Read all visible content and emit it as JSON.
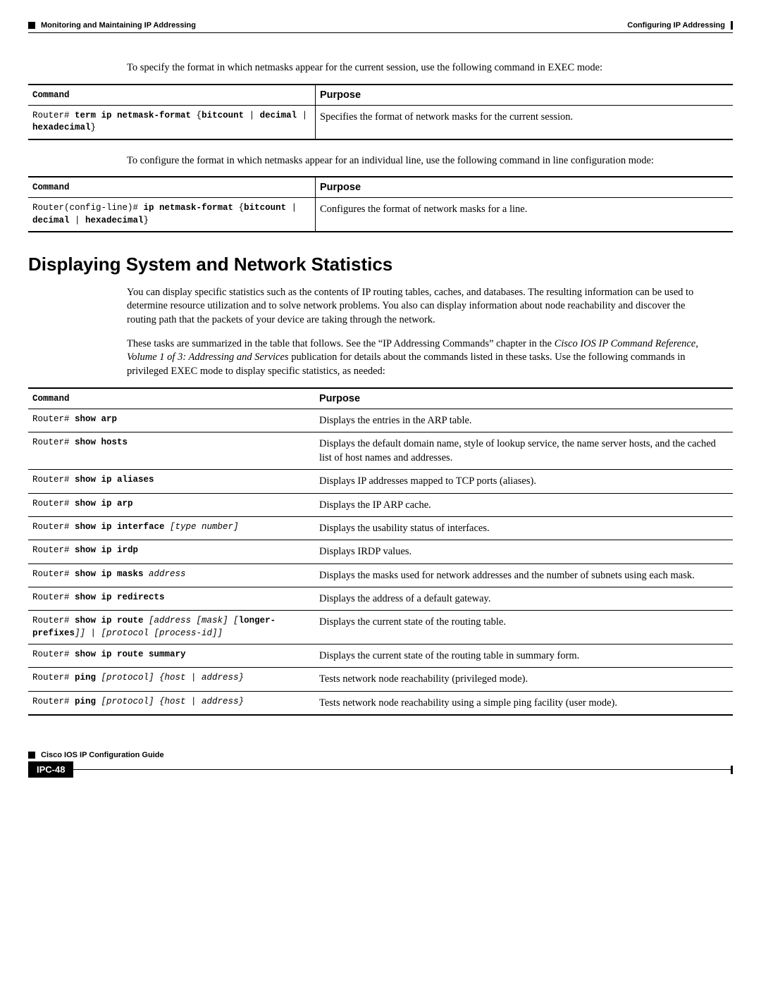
{
  "header": {
    "chapter": "Configuring IP Addressing",
    "section": "Monitoring and Maintaining IP Addressing"
  },
  "intro1": "To specify the format in which netmasks appear for the current session, use the following command in EXEC mode:",
  "table1": {
    "hdr_cmd": "Command",
    "hdr_purpose": "Purpose",
    "rows": [
      {
        "prompt": "Router# ",
        "kw1": "term ip netmask-format",
        "opts": " {",
        "opt1": "bitcount",
        "sep1": " | ",
        "opt2": "decimal",
        "sep2": " | ",
        "opt3": "hexadecimal",
        "close": "}",
        "purpose": "Specifies the format of network masks for the current session."
      }
    ]
  },
  "intro2": "To configure the format in which netmasks appear for an individual line, use the following command in line configuration mode:",
  "table2": {
    "hdr_cmd": "Command",
    "hdr_purpose": "Purpose",
    "rows": [
      {
        "prompt": "Router(config-line)# ",
        "kw1": "ip netmask-format",
        "opts": " {",
        "opt1": "bitcount",
        "sep1": " | ",
        "opt2": "decimal",
        "sep2": " | ",
        "opt3": "hexadecimal",
        "close": "}",
        "purpose": "Configures the format of network masks for a line."
      }
    ]
  },
  "heading2": "Displaying System and Network Statistics",
  "para2a": "You can display specific statistics such as the contents of IP routing tables, caches, and databases. The resulting information can be used to determine resource utilization and to solve network problems. You also can display information about node reachability and discover the routing path that the packets of your device are taking through the network.",
  "para2b_pre": "These tasks are summarized in the table that follows. See the “IP Addressing Commands” chapter in the ",
  "para2b_italic": "Cisco IOS IP Command Reference, Volume 1 of 3: Addressing and Services",
  "para2b_post": " publication for details about the commands listed in these tasks. Use the following commands in privileged EXEC mode to display specific statistics, as needed:",
  "table3": {
    "hdr_cmd": "Command",
    "hdr_purpose": "Purpose",
    "rows": [
      {
        "prompt": "Router# ",
        "kw": "show arp",
        "args": "",
        "purpose": "Displays the entries in the ARP table."
      },
      {
        "prompt": "Router# ",
        "kw": "show hosts",
        "args": "",
        "purpose": "Displays the default domain name, style of lookup service, the name server hosts, and the cached list of host names and addresses."
      },
      {
        "prompt": "Router# ",
        "kw": "show ip aliases",
        "args": "",
        "purpose": "Displays IP addresses mapped to TCP ports (aliases)."
      },
      {
        "prompt": "Router# ",
        "kw": "show ip arp",
        "args": "",
        "purpose": "Displays the IP ARP cache."
      },
      {
        "prompt": "Router# ",
        "kw": "show ip interface",
        "args": " [type number]",
        "purpose": "Displays the usability status of interfaces."
      },
      {
        "prompt": "Router# ",
        "kw": "show ip irdp",
        "args": "",
        "purpose": "Displays IRDP values."
      },
      {
        "prompt": "Router# ",
        "kw": "show ip masks",
        "args": " address",
        "purpose": "Displays the masks used for network addresses and the number of subnets using each mask."
      },
      {
        "prompt": "Router# ",
        "kw": "show ip redirects",
        "args": "",
        "purpose": "Displays the address of a default gateway."
      },
      {
        "prompt": "Router# ",
        "kw": "show ip route",
        "args_pre": " [address [mask] [",
        "kw2": "longer-prefixes",
        "args_post": "]] | [protocol [process-id]]",
        "purpose": "Displays the current state of the routing table."
      },
      {
        "prompt": "Router# ",
        "kw": "show ip route summary",
        "args": "",
        "purpose": "Displays the current state of the routing table in summary form."
      },
      {
        "prompt": "Router# ",
        "kw": "ping",
        "args": " [protocol] {host | address}",
        "purpose": "Tests network node reachability (privileged mode)."
      },
      {
        "prompt": "Router# ",
        "kw": "ping",
        "args": " [protocol] {host | address}",
        "purpose": "Tests network node reachability using a simple ping facility (user mode)."
      }
    ]
  },
  "footer": {
    "guide": "Cisco IOS IP Configuration Guide",
    "page": "IPC-48"
  }
}
